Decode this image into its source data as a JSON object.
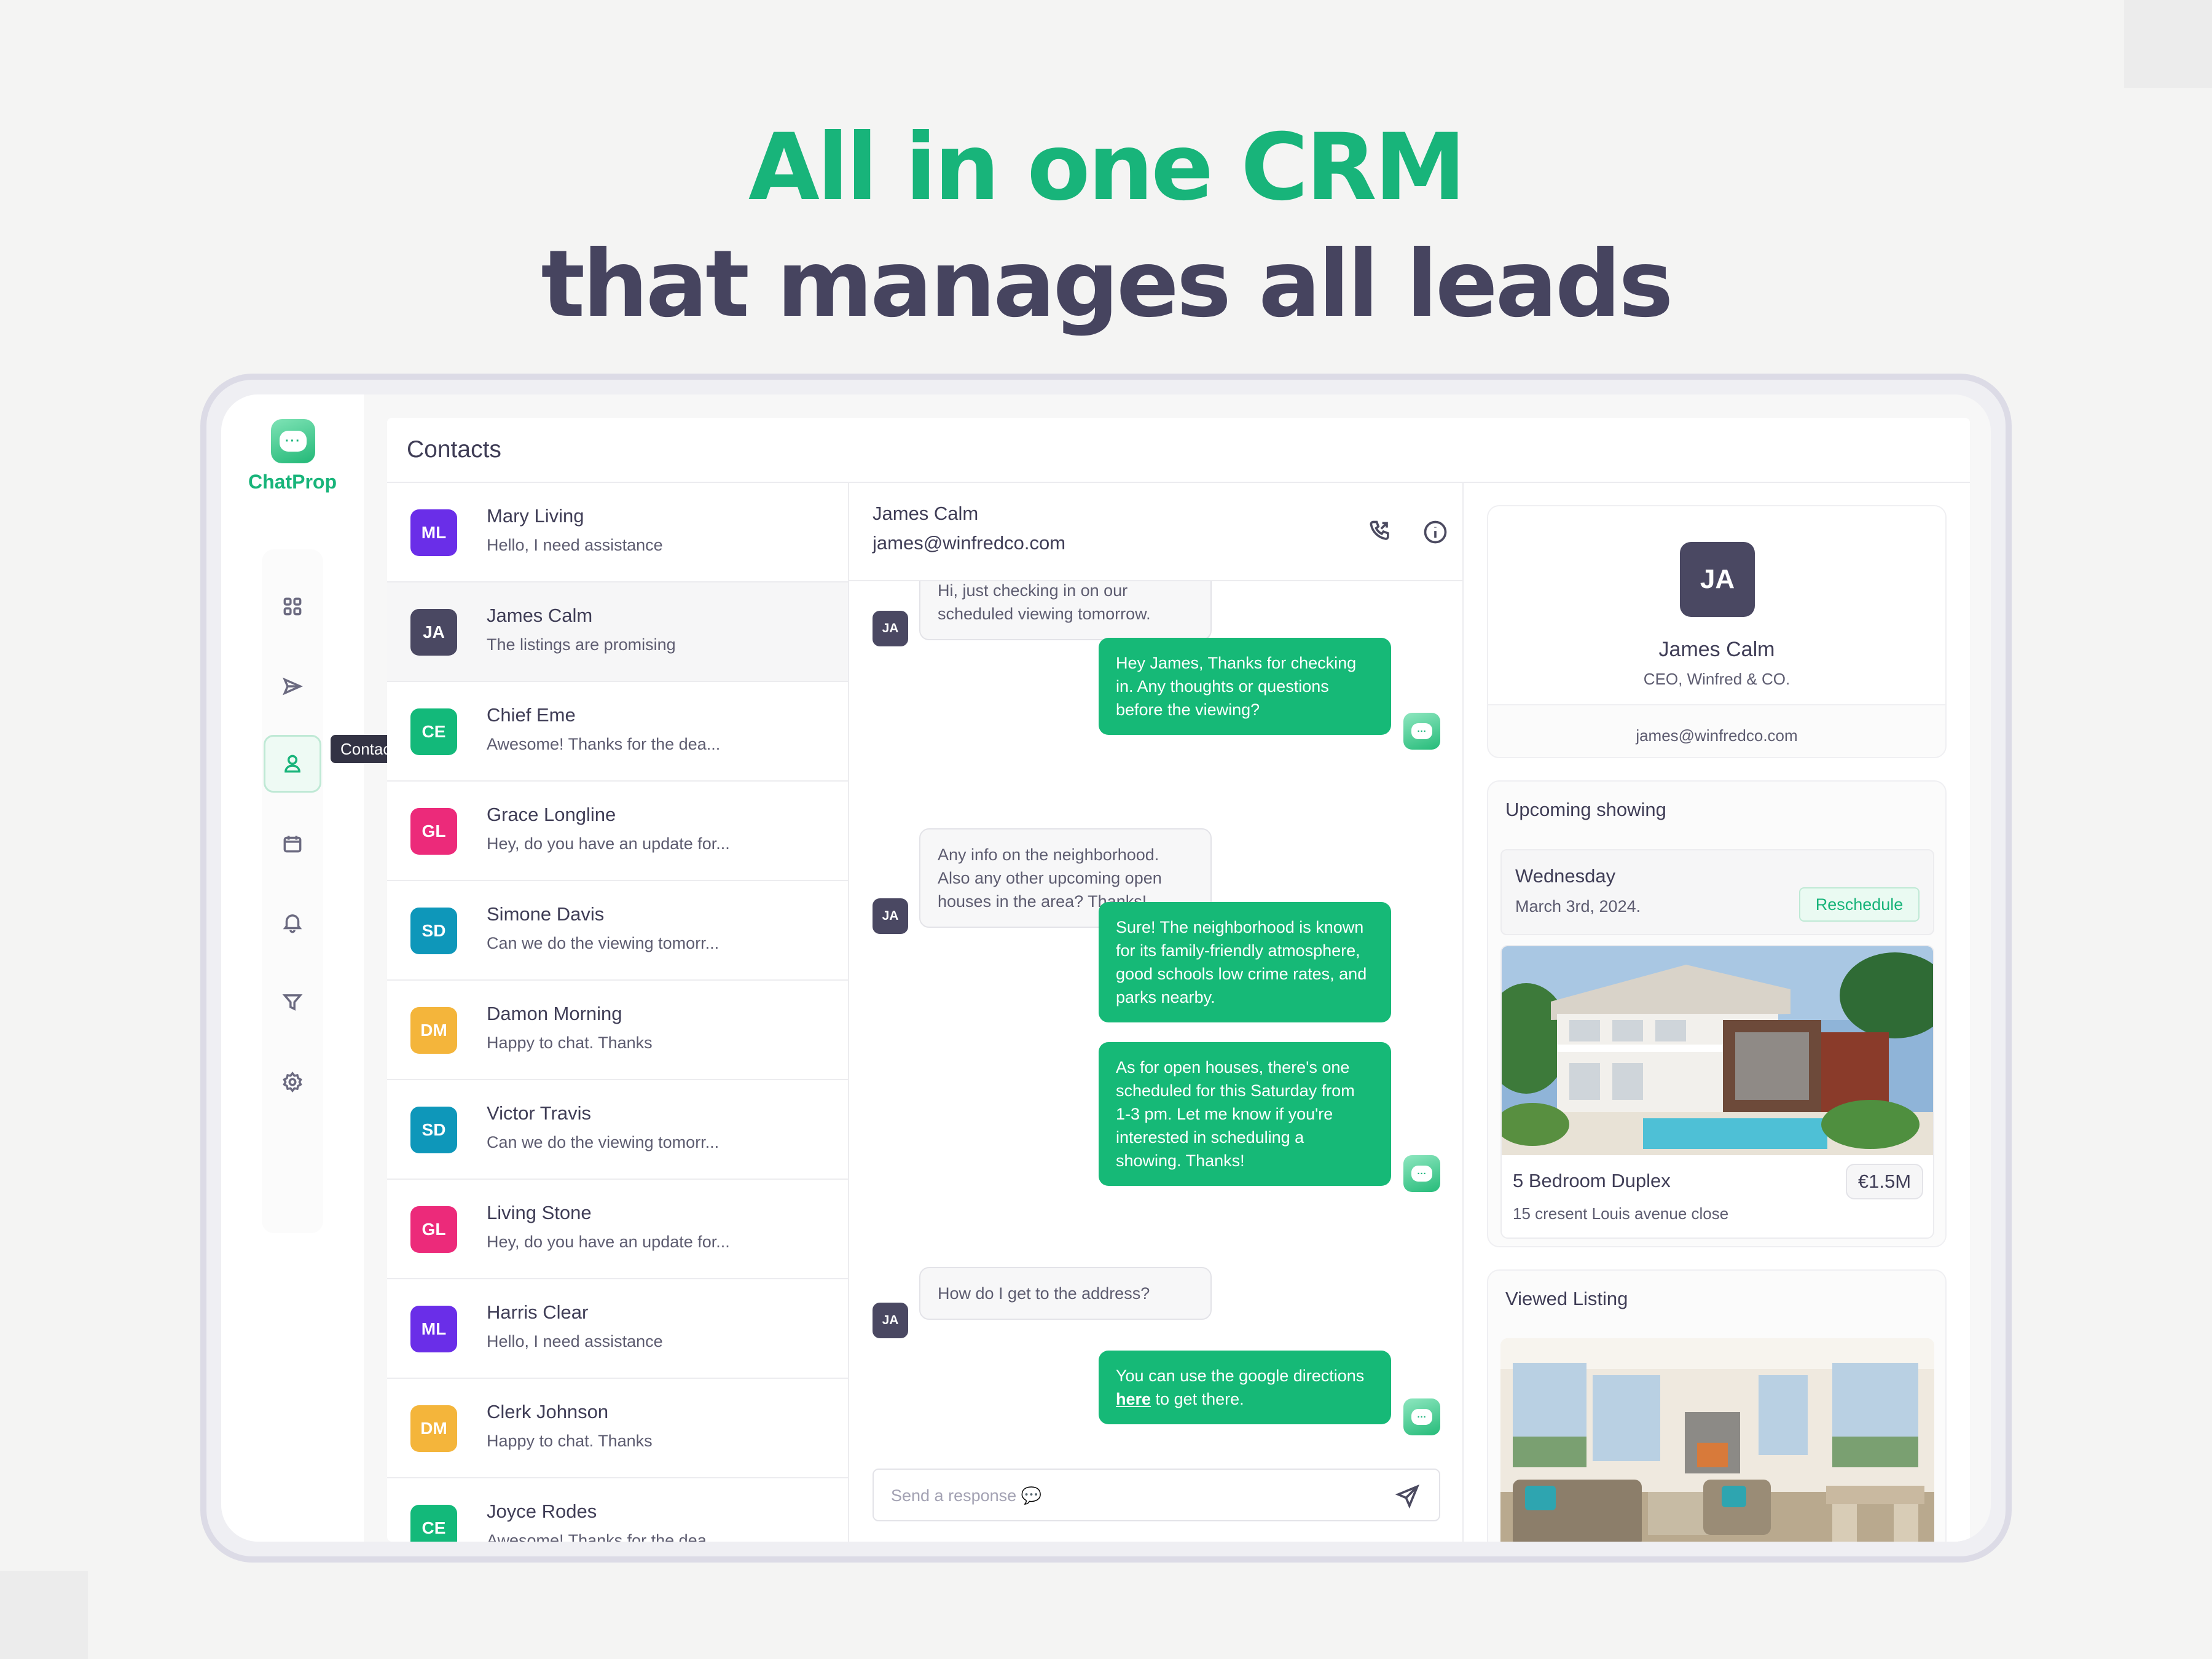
{
  "hero": {
    "line1": "All in one CRM",
    "line2": "that manages all leads"
  },
  "app": {
    "name": "ChatProp",
    "logo_icon": "chat-bubble-icon"
  },
  "nav": {
    "items": [
      {
        "icon": "grid-icon",
        "label": "Dashboard"
      },
      {
        "icon": "send-icon",
        "label": "Send"
      },
      {
        "icon": "user-icon",
        "label": "Contacts",
        "active": true
      },
      {
        "icon": "calendar-icon",
        "label": "Calendar"
      },
      {
        "icon": "bell-icon",
        "label": "Notifications"
      },
      {
        "icon": "filter-icon",
        "label": "Filter"
      },
      {
        "icon": "gear-icon",
        "label": "Settings"
      }
    ],
    "tooltip": "Contacts"
  },
  "page": {
    "title": "Contacts"
  },
  "contacts": [
    {
      "initials": "ML",
      "name": "Mary Living",
      "message": "Hello, I need assistance",
      "color": "#6a2ee8"
    },
    {
      "initials": "JA",
      "name": "James Calm",
      "message": "The listings are promising",
      "color": "#4a4862",
      "selected": true
    },
    {
      "initials": "CE",
      "name": "Chief Eme",
      "message": "Awesome! Thanks for the dea...",
      "color": "#13b97a"
    },
    {
      "initials": "GL",
      "name": "Grace Longline",
      "message": "Hey, do you have an update for...",
      "color": "#ec2a7a"
    },
    {
      "initials": "SD",
      "name": "Simone Davis",
      "message": "Can we do the viewing tomorr...",
      "color": "#0e97ba"
    },
    {
      "initials": "DM",
      "name": "Damon Morning",
      "message": "Happy to chat. Thanks",
      "color": "#f4b53b"
    },
    {
      "initials": "SD",
      "name": "Victor Travis",
      "message": "Can we do the viewing tomorr...",
      "color": "#0e97ba"
    },
    {
      "initials": "GL",
      "name": "Living Stone",
      "message": "Hey, do you have an update for...",
      "color": "#ec2a7a"
    },
    {
      "initials": "ML",
      "name": "Harris Clear",
      "message": "Hello, I need assistance",
      "color": "#6a2ee8"
    },
    {
      "initials": "DM",
      "name": "Clerk Johnson",
      "message": "Happy to chat. Thanks",
      "color": "#f4b53b"
    },
    {
      "initials": "CE",
      "name": "Joyce Rodes",
      "message": "Awesome! Thanks for the dea...",
      "color": "#13b97a"
    }
  ],
  "chat": {
    "name": "James Calm",
    "email": "james@winfredco.com",
    "header_icons": [
      "phone-icon",
      "info-icon"
    ],
    "contact_initials": "JA",
    "messages": [
      {
        "from": "contact",
        "text": "Hi, just checking in on our scheduled viewing tomorrow."
      },
      {
        "from": "agent",
        "text": "Hey James, Thanks for checking in. Any thoughts or questions before the viewing?"
      },
      {
        "from": "contact",
        "text": "Any info on the neighborhood. Also any other upcoming open houses in the area? Thanks!"
      },
      {
        "from": "agent",
        "text": "Sure! The neighborhood is known for its family-friendly atmosphere, good schools low crime rates, and parks nearby."
      },
      {
        "from": "agent",
        "text": "As for open houses, there's one scheduled for this Saturday from 1-3 pm. Let me know if you're interested in scheduling a showing. Thanks!"
      },
      {
        "from": "contact",
        "text": "How do I get to the address?"
      },
      {
        "from": "agent",
        "text_before": "You can use the google directions ",
        "link": "here",
        "text_after": " to get there."
      }
    ],
    "composer": {
      "placeholder": "Send a response 💬",
      "value": ""
    }
  },
  "profile": {
    "initials": "JA",
    "name": "James Calm",
    "role": "CEO, Winfred & CO.",
    "email": "james@winfredco.com"
  },
  "upcoming": {
    "title": "Upcoming showing",
    "day": "Wednesday",
    "date": "March 3rd, 2024.",
    "reschedule_label": "Reschedule",
    "listing": {
      "title": "5 Bedroom Duplex",
      "address": "15 cresent Louis avenue close",
      "price": "€1.5M"
    }
  },
  "viewed": {
    "title": "Viewed Listing"
  },
  "colors": {
    "accent": "#18b47a",
    "heading_dark": "#46445f"
  }
}
